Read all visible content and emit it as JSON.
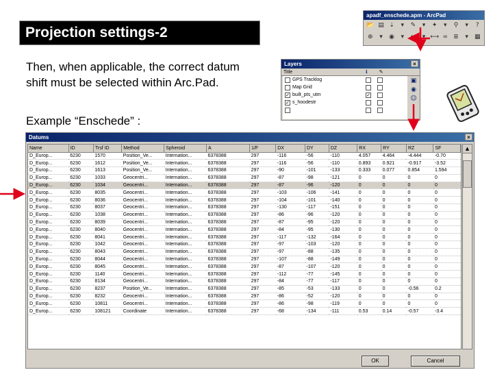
{
  "slide": {
    "title": "Projection settings-2",
    "body": "Then, when applicable, the correct datum shift must be selected within Arc.Pad.",
    "example": "Example “Enschede” :"
  },
  "toolbar_window": {
    "title": "apadf_enschede.apm - ArcPad",
    "row1_icons": [
      "open-icon",
      "save-icon",
      "gps-icon",
      "dropdown-icon",
      "edit-icon",
      "dropdown-icon",
      "capture-icon",
      "dropdown-icon",
      "identify-icon",
      "dropdown-icon",
      "help-icon"
    ],
    "row2_icons": [
      "zoom-icon",
      "dropdown-icon",
      "globe-icon",
      "dropdown-icon",
      "back-icon",
      "dropdown-icon",
      "measure-icon",
      "binoculars-icon",
      "layers-icon",
      "dropdown-icon",
      "map-icon"
    ]
  },
  "layers_window": {
    "title": "Layers",
    "columns": [
      "Title"
    ],
    "rows": [
      {
        "visible": "",
        "label": "GPS Tracklog",
        "edit": ""
      },
      {
        "visible": "",
        "label": "Map Grid",
        "edit": ""
      },
      {
        "visible": "✓",
        "label": "built_pts_utm",
        "edit": "✓"
      },
      {
        "visible": "✓",
        "label": "s_hoodestr",
        "edit": ""
      },
      {
        "visible": "",
        "label": "",
        "edit": ""
      }
    ]
  },
  "datums_window": {
    "title": "Datums",
    "columns": [
      "Name",
      "ID",
      "Trsf ID",
      "Method",
      "Spheroid",
      "A",
      "1/F",
      "DX",
      "DY",
      "DZ",
      "RX",
      "RY",
      "RZ",
      "SF"
    ],
    "rows": [
      [
        "D_Europ...",
        "6230",
        "1570",
        "Position_Ve...",
        "Internation...",
        "6378388",
        "297",
        "-116",
        "-56",
        "-110",
        "4.057",
        "4.464",
        "-4.444",
        "-0.70"
      ],
      [
        "D_Europ...",
        "6230",
        "1612",
        "Position_Ve...",
        "Internation...",
        "6378388",
        "297",
        "-116",
        "-56",
        "-110",
        "0.893",
        "0.921",
        "-0.917",
        "-3.52"
      ],
      [
        "D_Europ...",
        "6230",
        "1613",
        "Position_Ve...",
        "Internation...",
        "6378388",
        "297",
        "-90",
        "-101",
        "-133",
        "0.333",
        "0.077",
        "0.854",
        "1.594"
      ],
      [
        "D_Europ...",
        "6230",
        "1033",
        "Geocentri...",
        "Internation...",
        "6378388",
        "297",
        "-87",
        "-98",
        "-121",
        "0",
        "0",
        "0",
        "0"
      ],
      [
        "D_Europ...",
        "6230",
        "1034",
        "Geocentri...",
        "Internation...",
        "6378388",
        "297",
        "-87",
        "-96",
        "-120",
        "0",
        "0",
        "0",
        "0"
      ],
      [
        "D_Europ...",
        "6230",
        "8035",
        "Geocentri...",
        "Internation...",
        "6378388",
        "297",
        "-103",
        "-106",
        "-141",
        "0",
        "0",
        "0",
        "0"
      ],
      [
        "D_Europ...",
        "6230",
        "8036",
        "Geocentri...",
        "Internation...",
        "6378388",
        "297",
        "-104",
        "-101",
        "-140",
        "0",
        "0",
        "0",
        "0"
      ],
      [
        "D_Europ...",
        "6230",
        "8037",
        "Geocentri...",
        "Internation...",
        "6378388",
        "297",
        "-130",
        "-117",
        "-151",
        "0",
        "0",
        "0",
        "0"
      ],
      [
        "D_Europ...",
        "6230",
        "1038",
        "Geocentri...",
        "Internation...",
        "6378388",
        "297",
        "-86",
        "-96",
        "-120",
        "0",
        "0",
        "0",
        "0"
      ],
      [
        "D_Europ...",
        "6230",
        "8039",
        "Geocentri...",
        "Internation...",
        "6378388",
        "297",
        "-87",
        "-95",
        "-120",
        "0",
        "0",
        "0",
        "0"
      ],
      [
        "D_Europ...",
        "6230",
        "8040",
        "Geocentri...",
        "Internation...",
        "6378388",
        "297",
        "-84",
        "-95",
        "-130",
        "0",
        "0",
        "0",
        "0"
      ],
      [
        "D_Europ...",
        "6230",
        "8041",
        "Geocentri...",
        "Internation...",
        "6378388",
        "297",
        "-117",
        "-132",
        "-164",
        "0",
        "0",
        "0",
        "0"
      ],
      [
        "D_Europ...",
        "6230",
        "1042",
        "Geocentri...",
        "Internation...",
        "6378388",
        "297",
        "-97",
        "-103",
        "-120",
        "0",
        "0",
        "0",
        "0"
      ],
      [
        "D_Europ...",
        "6230",
        "8043",
        "Geocentri...",
        "Internation...",
        "6378388",
        "297",
        "-97",
        "-88",
        "-135",
        "0",
        "0",
        "0",
        "0"
      ],
      [
        "D_Europ...",
        "6230",
        "8044",
        "Geocentri...",
        "Internation...",
        "6378388",
        "297",
        "-107",
        "-88",
        "-149",
        "0",
        "0",
        "0",
        "0"
      ],
      [
        "D_Europ...",
        "6230",
        "8045",
        "Geocentri...",
        "Internation...",
        "6378388",
        "297",
        "-87",
        "-107",
        "-120",
        "0",
        "0",
        "0",
        "0"
      ],
      [
        "D_Europ...",
        "6230",
        "1140",
        "Geocentri...",
        "Internation...",
        "6378388",
        "297",
        "-112",
        "-77",
        "-145",
        "0",
        "0",
        "0",
        "0"
      ],
      [
        "D_Europ...",
        "6230",
        "8134",
        "Geocentri...",
        "Internation...",
        "6378388",
        "297",
        "-84",
        "-77",
        "-117",
        "0",
        "0",
        "0",
        "0"
      ],
      [
        "D_Europ...",
        "6230",
        "8237",
        "Position_Ve...",
        "Internation...",
        "6378388",
        "297",
        "-85",
        "-53",
        "-133",
        "0",
        "0",
        "-0.56",
        "0.2"
      ],
      [
        "D_Europ...",
        "6230",
        "8232",
        "Geocentri...",
        "Internation...",
        "6378388",
        "297",
        "-86",
        "-52",
        "-120",
        "0",
        "0",
        "0",
        "0"
      ],
      [
        "D_Europ...",
        "6230",
        "10811",
        "Geocentri...",
        "Internation...",
        "6378388",
        "297",
        "-86",
        "-98",
        "-119",
        "0",
        "0",
        "0",
        "0"
      ],
      [
        "D_Europ...",
        "6230",
        "108121",
        "Coordinate",
        "Internation...",
        "6378388",
        "297",
        "-68",
        "-134",
        "-111",
        "0.53",
        "0.14",
        "-0.57",
        "-3.4"
      ]
    ],
    "selected_row": 4,
    "ok_label": "OK",
    "cancel_label": "Cancel"
  },
  "colors": {
    "arrow": "#e0001a",
    "caption": "#0a246a"
  }
}
